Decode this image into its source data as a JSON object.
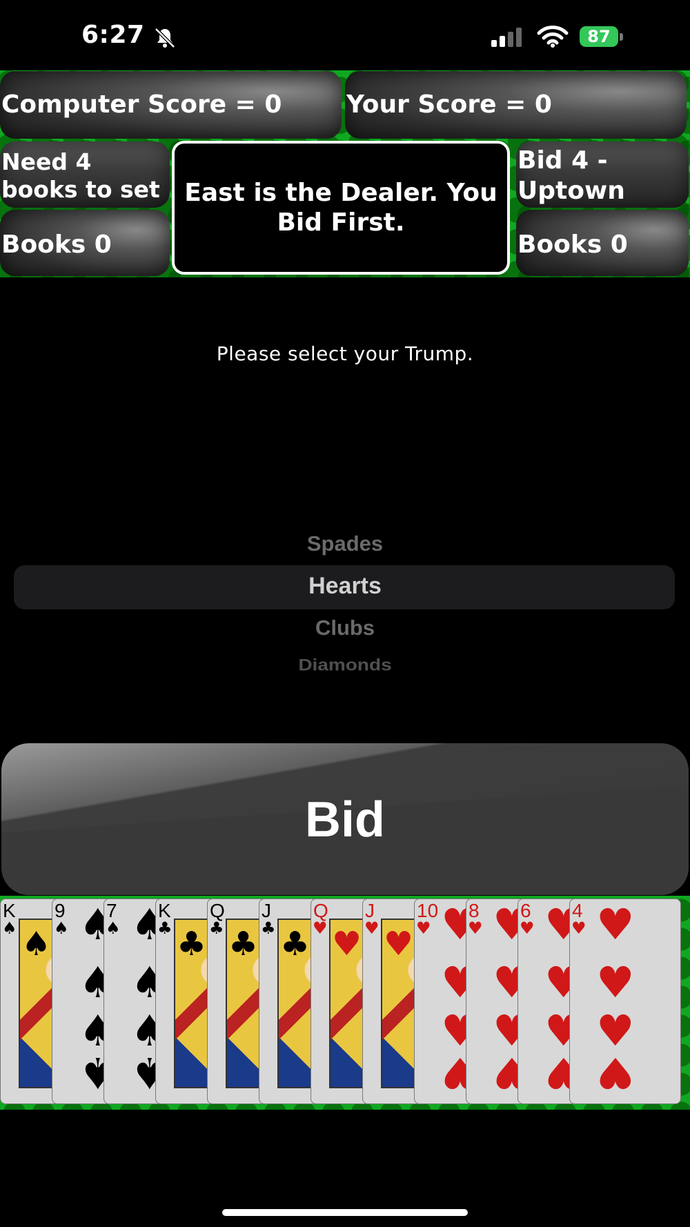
{
  "status_bar": {
    "time": "6:27",
    "battery": "87"
  },
  "scores": {
    "computer": "Computer Score = 0",
    "player": "Your Score = 0"
  },
  "left_panel": {
    "need": "Need 4 books to set",
    "books": "Books 0"
  },
  "right_panel": {
    "bid": "Bid 4 - Uptown",
    "books": "Books 0"
  },
  "message": "East is the Dealer. You Bid First.",
  "prompt": "Please select your Trump.",
  "trump_picker": {
    "options": [
      "Spades",
      "Hearts",
      "Clubs",
      "Diamonds"
    ],
    "selected": "Hearts"
  },
  "bid_button": {
    "label": "Bid"
  },
  "hand": [
    {
      "rank": "K",
      "suit": "♠",
      "color": "#000000"
    },
    {
      "rank": "9",
      "suit": "♠",
      "color": "#000000"
    },
    {
      "rank": "7",
      "suit": "♠",
      "color": "#000000"
    },
    {
      "rank": "K",
      "suit": "♣",
      "color": "#000000"
    },
    {
      "rank": "Q",
      "suit": "♣",
      "color": "#000000"
    },
    {
      "rank": "J",
      "suit": "♣",
      "color": "#000000"
    },
    {
      "rank": "Q",
      "suit": "♥",
      "color": "#d01818"
    },
    {
      "rank": "J",
      "suit": "♥",
      "color": "#d01818"
    },
    {
      "rank": "10",
      "suit": "♥",
      "color": "#d01818"
    },
    {
      "rank": "8",
      "suit": "♥",
      "color": "#d01818"
    },
    {
      "rank": "6",
      "suit": "♥",
      "color": "#d01818"
    },
    {
      "rank": "4",
      "suit": "♥",
      "color": "#d01818"
    }
  ],
  "colors": {
    "felt": "#10a820",
    "battery": "#34c759",
    "panel": "#3a3a3a"
  }
}
